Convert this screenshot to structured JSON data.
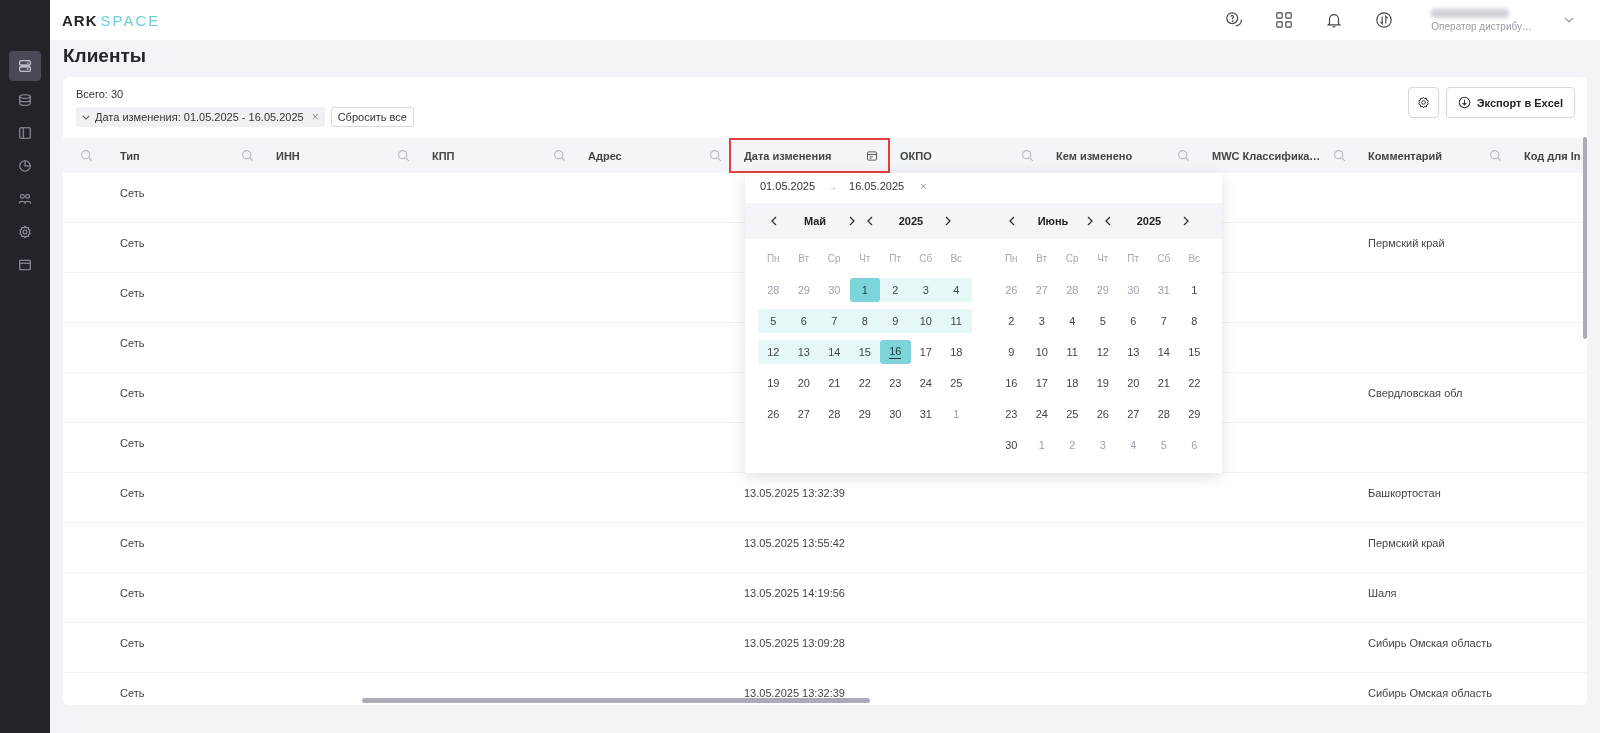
{
  "logo": {
    "part1": "ARK",
    "part2": "SPACE"
  },
  "user": {
    "role": "Оператор дистрибу…"
  },
  "sidebar": {
    "items": [
      {
        "selected": true
      },
      {
        "selected": false
      },
      {
        "selected": false
      },
      {
        "selected": false
      },
      {
        "selected": false
      },
      {
        "selected": false
      },
      {
        "selected": false
      }
    ]
  },
  "page_title": "Клиенты",
  "total": "Всего: 30",
  "filter_chip": {
    "label": "Дата изменения: 01.05.2025 - 16.05.2025",
    "close": "×"
  },
  "reset_button": "Сбросить все",
  "export_button": "Экспорт в Excel",
  "table": {
    "columns": [
      {
        "label": "Тип",
        "kind": "searchable",
        "highlighted": false
      },
      {
        "label": "ИНН",
        "kind": "searchable",
        "highlighted": false
      },
      {
        "label": "КПП",
        "kind": "searchable",
        "highlighted": false
      },
      {
        "label": "Адрес",
        "kind": "searchable",
        "highlighted": false
      },
      {
        "label": "Дата изменения",
        "kind": "date",
        "highlighted": true
      },
      {
        "label": "ОКПО",
        "kind": "searchable",
        "highlighted": false
      },
      {
        "label": "Кем изменено",
        "kind": "searchable",
        "highlighted": false
      },
      {
        "label": "MWC Классифика…",
        "kind": "searchable",
        "highlighted": false
      },
      {
        "label": "Комментарий",
        "kind": "searchable",
        "highlighted": false
      },
      {
        "label": "Код для In",
        "kind": "plain",
        "highlighted": false
      }
    ],
    "rows": [
      {
        "type": "Сеть"
      },
      {
        "type": "Сеть",
        "comment": "Пермский край"
      },
      {
        "type": "Сеть"
      },
      {
        "type": "Сеть"
      },
      {
        "type": "Сеть",
        "comment": "Свердловская обл"
      },
      {
        "type": "Сеть"
      },
      {
        "type": "Сеть",
        "modified": "13.05.2025 13:32:39",
        "comment": "Башкортостан"
      },
      {
        "type": "Сеть",
        "modified": "13.05.2025 13:55:42",
        "comment": "Пермский край"
      },
      {
        "type": "Сеть",
        "modified": "13.05.2025 14:19:56",
        "comment": "Шаля"
      },
      {
        "type": "Сеть",
        "modified": "13.05.2025 13:09:28",
        "comment": "Сибирь Омская область"
      },
      {
        "type": "Сеть",
        "modified": "13.05.2025 13:32:39",
        "comment": "Сибирь Омская область"
      }
    ]
  },
  "date_picker": {
    "start": "01.05.2025",
    "arrow": "→",
    "end": "16.05.2025",
    "clear": "×",
    "months": [
      {
        "name": "Май",
        "year": "2025",
        "weekdays": [
          "Пн",
          "Вт",
          "Ср",
          "Чт",
          "Пт",
          "Сб",
          "Вс"
        ],
        "weeks": [
          [
            {
              "n": "28",
              "muted": true,
              "in_range": false,
              "selected": false,
              "today": false
            },
            {
              "n": "29",
              "muted": true,
              "in_range": false,
              "selected": false,
              "today": false
            },
            {
              "n": "30",
              "muted": true,
              "in_range": false,
              "selected": false,
              "today": false
            },
            {
              "n": "1",
              "muted": false,
              "in_range": true,
              "selected": true,
              "today": false
            },
            {
              "n": "2",
              "muted": false,
              "in_range": true,
              "selected": false,
              "today": false
            },
            {
              "n": "3",
              "muted": false,
              "in_range": true,
              "selected": false,
              "today": false
            },
            {
              "n": "4",
              "muted": false,
              "in_range": true,
              "selected": false,
              "today": false
            }
          ],
          [
            {
              "n": "5",
              "muted": false,
              "in_range": true,
              "selected": false,
              "today": false
            },
            {
              "n": "6",
              "muted": false,
              "in_range": true,
              "selected": false,
              "today": false
            },
            {
              "n": "7",
              "muted": false,
              "in_range": true,
              "selected": false,
              "today": false
            },
            {
              "n": "8",
              "muted": false,
              "in_range": true,
              "selected": false,
              "today": false
            },
            {
              "n": "9",
              "muted": false,
              "in_range": true,
              "selected": false,
              "today": false
            },
            {
              "n": "10",
              "muted": false,
              "in_range": true,
              "selected": false,
              "today": false
            },
            {
              "n": "11",
              "muted": false,
              "in_range": true,
              "selected": false,
              "today": false
            }
          ],
          [
            {
              "n": "12",
              "muted": false,
              "in_range": true,
              "selected": false,
              "today": false
            },
            {
              "n": "13",
              "muted": false,
              "in_range": true,
              "selected": false,
              "today": false
            },
            {
              "n": "14",
              "muted": false,
              "in_range": true,
              "selected": false,
              "today": false
            },
            {
              "n": "15",
              "muted": false,
              "in_range": true,
              "selected": false,
              "today": false
            },
            {
              "n": "16",
              "muted": false,
              "in_range": true,
              "selected": true,
              "today": true
            },
            {
              "n": "17",
              "muted": false,
              "in_range": false,
              "selected": false,
              "today": false
            },
            {
              "n": "18",
              "muted": false,
              "in_range": false,
              "selected": false,
              "today": false
            }
          ],
          [
            {
              "n": "19",
              "muted": false,
              "in_range": false,
              "selected": false,
              "today": false
            },
            {
              "n": "20",
              "muted": false,
              "in_range": false,
              "selected": false,
              "today": false
            },
            {
              "n": "21",
              "muted": false,
              "in_range": false,
              "selected": false,
              "today": false
            },
            {
              "n": "22",
              "muted": false,
              "in_range": false,
              "selected": false,
              "today": false
            },
            {
              "n": "23",
              "muted": false,
              "in_range": false,
              "selected": false,
              "today": false
            },
            {
              "n": "24",
              "muted": false,
              "in_range": false,
              "selected": false,
              "today": false
            },
            {
              "n": "25",
              "muted": false,
              "in_range": false,
              "selected": false,
              "today": false
            }
          ],
          [
            {
              "n": "26",
              "muted": false,
              "in_range": false,
              "selected": false,
              "today": false
            },
            {
              "n": "27",
              "muted": false,
              "in_range": false,
              "selected": false,
              "today": false
            },
            {
              "n": "28",
              "muted": false,
              "in_range": false,
              "selected": false,
              "today": false
            },
            {
              "n": "29",
              "muted": false,
              "in_range": false,
              "selected": false,
              "today": false
            },
            {
              "n": "30",
              "muted": false,
              "in_range": false,
              "selected": false,
              "today": false
            },
            {
              "n": "31",
              "muted": false,
              "in_range": false,
              "selected": false,
              "today": false
            },
            {
              "n": "1",
              "muted": true,
              "in_range": false,
              "selected": false,
              "today": false
            }
          ]
        ]
      },
      {
        "name": "Июнь",
        "year": "2025",
        "weekdays": [
          "Пн",
          "Вт",
          "Ср",
          "Чт",
          "Пт",
          "Сб",
          "Вс"
        ],
        "weeks": [
          [
            {
              "n": "26",
              "muted": true,
              "in_range": false,
              "selected": false,
              "today": false
            },
            {
              "n": "27",
              "muted": true,
              "in_range": false,
              "selected": false,
              "today": false
            },
            {
              "n": "28",
              "muted": true,
              "in_range": false,
              "selected": false,
              "today": false
            },
            {
              "n": "29",
              "muted": true,
              "in_range": false,
              "selected": false,
              "today": false
            },
            {
              "n": "30",
              "muted": true,
              "in_range": false,
              "selected": false,
              "today": false
            },
            {
              "n": "31",
              "muted": true,
              "in_range": false,
              "selected": false,
              "today": false
            },
            {
              "n": "1",
              "muted": false,
              "in_range": false,
              "selected": false,
              "today": false
            }
          ],
          [
            {
              "n": "2",
              "muted": false,
              "in_range": false,
              "selected": false,
              "today": false
            },
            {
              "n": "3",
              "muted": false,
              "in_range": false,
              "selected": false,
              "today": false
            },
            {
              "n": "4",
              "muted": false,
              "in_range": false,
              "selected": false,
              "today": false
            },
            {
              "n": "5",
              "muted": false,
              "in_range": false,
              "selected": false,
              "today": false
            },
            {
              "n": "6",
              "muted": false,
              "in_range": false,
              "selected": false,
              "today": false
            },
            {
              "n": "7",
              "muted": false,
              "in_range": false,
              "selected": false,
              "today": false
            },
            {
              "n": "8",
              "muted": false,
              "in_range": false,
              "selected": false,
              "today": false
            }
          ],
          [
            {
              "n": "9",
              "muted": false,
              "in_range": false,
              "selected": false,
              "today": false
            },
            {
              "n": "10",
              "muted": false,
              "in_range": false,
              "selected": false,
              "today": false
            },
            {
              "n": "11",
              "muted": false,
              "in_range": false,
              "selected": false,
              "today": false
            },
            {
              "n": "12",
              "muted": false,
              "in_range": false,
              "selected": false,
              "today": false
            },
            {
              "n": "13",
              "muted": false,
              "in_range": false,
              "selected": false,
              "today": false
            },
            {
              "n": "14",
              "muted": false,
              "in_range": false,
              "selected": false,
              "today": false
            },
            {
              "n": "15",
              "muted": false,
              "in_range": false,
              "selected": false,
              "today": false
            }
          ],
          [
            {
              "n": "16",
              "muted": false,
              "in_range": false,
              "selected": false,
              "today": false
            },
            {
              "n": "17",
              "muted": false,
              "in_range": false,
              "selected": false,
              "today": false
            },
            {
              "n": "18",
              "muted": false,
              "in_range": false,
              "selected": false,
              "today": false
            },
            {
              "n": "19",
              "muted": false,
              "in_range": false,
              "selected": false,
              "today": false
            },
            {
              "n": "20",
              "muted": false,
              "in_range": false,
              "selected": false,
              "today": false
            },
            {
              "n": "21",
              "muted": false,
              "in_range": false,
              "selected": false,
              "today": false
            },
            {
              "n": "22",
              "muted": false,
              "in_range": false,
              "selected": false,
              "today": false
            }
          ],
          [
            {
              "n": "23",
              "muted": false,
              "in_range": false,
              "selected": false,
              "today": false
            },
            {
              "n": "24",
              "muted": false,
              "in_range": false,
              "selected": false,
              "today": false
            },
            {
              "n": "25",
              "muted": false,
              "in_range": false,
              "selected": false,
              "today": false
            },
            {
              "n": "26",
              "muted": false,
              "in_range": false,
              "selected": false,
              "today": false
            },
            {
              "n": "27",
              "muted": false,
              "in_range": false,
              "selected": false,
              "today": false
            },
            {
              "n": "28",
              "muted": false,
              "in_range": false,
              "selected": false,
              "today": false
            },
            {
              "n": "29",
              "muted": false,
              "in_range": false,
              "selected": false,
              "today": false
            }
          ],
          [
            {
              "n": "30",
              "muted": false,
              "in_range": false,
              "selected": false,
              "today": false
            },
            {
              "n": "1",
              "muted": true,
              "in_range": false,
              "selected": false,
              "today": false
            },
            {
              "n": "2",
              "muted": true,
              "in_range": false,
              "selected": false,
              "today": false
            },
            {
              "n": "3",
              "muted": true,
              "in_range": false,
              "selected": false,
              "today": false
            },
            {
              "n": "4",
              "muted": true,
              "in_range": false,
              "selected": false,
              "today": false
            },
            {
              "n": "5",
              "muted": true,
              "in_range": false,
              "selected": false,
              "today": false
            },
            {
              "n": "6",
              "muted": true,
              "in_range": false,
              "selected": false,
              "today": false
            }
          ]
        ]
      }
    ]
  }
}
